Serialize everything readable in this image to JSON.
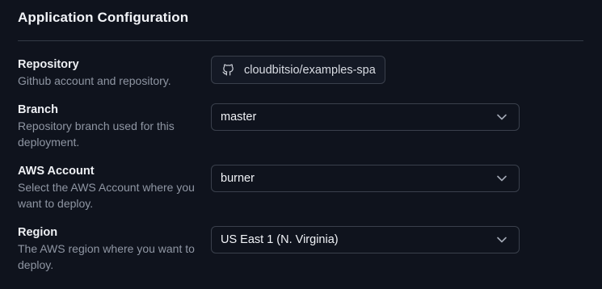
{
  "section": {
    "title": "Application Configuration"
  },
  "fields": {
    "repository": {
      "label": "Repository",
      "description": "Github account and repository.",
      "value": "cloudbitsio/examples-spa",
      "icon": "github-icon"
    },
    "branch": {
      "label": "Branch",
      "description": "Repository branch used for this deployment.",
      "value": "master",
      "icon": "chevron-down-icon"
    },
    "aws_account": {
      "label": "AWS Account",
      "description": "Select the AWS Account where you want to deploy.",
      "value": "burner",
      "icon": "chevron-down-icon"
    },
    "region": {
      "label": "Region",
      "description": "The AWS region where you want to deploy.",
      "value": "US East 1 (N. Virginia)",
      "icon": "chevron-down-icon"
    }
  },
  "colors": {
    "background": "#0f131d",
    "border": "#3a404c",
    "text_primary": "#f1f3f7",
    "text_muted": "#8f96a3"
  }
}
